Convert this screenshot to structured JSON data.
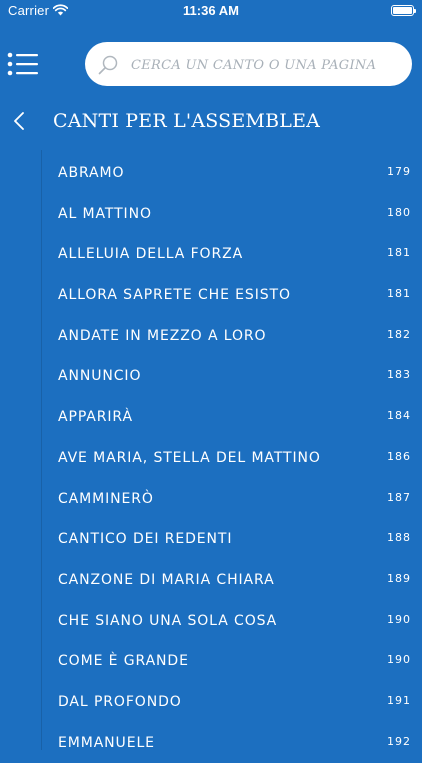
{
  "status_bar": {
    "carrier": "Carrier",
    "time": "11:36 AM"
  },
  "search": {
    "placeholder": "CERCA UN CANTO O UNA PAGINA"
  },
  "page": {
    "title": "CANTI PER L'ASSEMBLEA"
  },
  "songs": [
    {
      "title": "ABRAMO",
      "page": "179"
    },
    {
      "title": "AL MATTINO",
      "page": "180"
    },
    {
      "title": "ALLELUIA DELLA FORZA",
      "page": "181"
    },
    {
      "title": "ALLORA SAPRETE CHE ESISTO",
      "page": "181"
    },
    {
      "title": "ANDATE IN MEZZO A LORO",
      "page": "182"
    },
    {
      "title": "ANNUNCIO",
      "page": "183"
    },
    {
      "title": "APPARIRÀ",
      "page": "184"
    },
    {
      "title": "AVE MARIA, STELLA DEL MATTINO",
      "page": "186"
    },
    {
      "title": "CAMMINERÒ",
      "page": "187"
    },
    {
      "title": "CANTICO DEI REDENTI",
      "page": "188"
    },
    {
      "title": "CANZONE DI MARIA CHIARA",
      "page": "189"
    },
    {
      "title": "CHE SIANO UNA SOLA COSA",
      "page": "190"
    },
    {
      "title": "COME È GRANDE",
      "page": "190"
    },
    {
      "title": "DAL PROFONDO",
      "page": "191"
    },
    {
      "title": "EMMANUELE",
      "page": "192"
    }
  ],
  "colors": {
    "background": "#1c6fc0",
    "text": "#ffffff",
    "search_background": "#ffffff"
  },
  "icons": {
    "status": [
      "wifi-icon",
      "battery-icon"
    ],
    "header": [
      "hamburger-menu-icon",
      "search-icon",
      "chevron-left-icon"
    ]
  }
}
